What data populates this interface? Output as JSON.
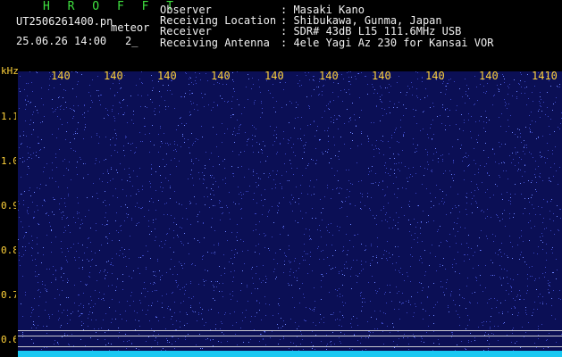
{
  "header": {
    "app_name": "H R O F F T",
    "file_name": "UT2506261400.pn",
    "mode": "meteor",
    "datetime": "25.06.26 14:00",
    "count": "2_",
    "fields": [
      {
        "label": "Observer",
        "value": ": Masaki Kano"
      },
      {
        "label": "Receiving Location",
        "value": ": Shibukawa, Gunma, Japan"
      },
      {
        "label": "Receiver",
        "value": ": SDR# 43dB L15 111.6MHz USB"
      },
      {
        "label": "Receiving Antenna",
        "value": ": 4ele Yagi Az 230 for Kansai VOR"
      }
    ]
  },
  "spectrogram": {
    "y_unit": "kHz",
    "y_ticks": [
      "1.1",
      "1.0",
      "0.9",
      "0.8",
      "0.7",
      "0.6"
    ],
    "x_ticks": [
      "140",
      "140",
      "140",
      "140",
      "140",
      "140",
      "140",
      "140",
      "140",
      "1410"
    ],
    "colors": {
      "background": "#0b0f55",
      "noise": "#3a46c0",
      "speck": "#6f86ff",
      "axis_text": "#ffd23a",
      "baseline": "#19c8f2"
    }
  }
}
